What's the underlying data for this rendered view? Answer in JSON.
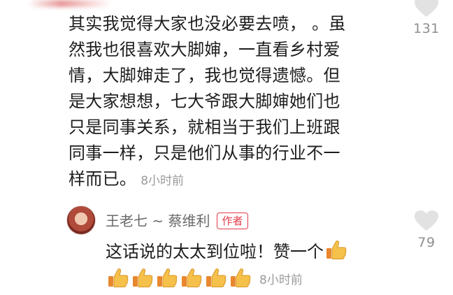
{
  "comment": {
    "lines": [
      "其实我觉得大家也没必要去喷，  。虽",
      "然我也很喜欢大脚婶，一直看乡村爱",
      "情，大脚婶走了，我也觉得遗憾。但",
      "是大家想想，七大爷跟大脚婶她们也",
      "只是同事关系，就相当于我们上班跟",
      "同事一样，只是他们从事的行业不一",
      "样而已。"
    ],
    "time": "8小时前",
    "likes": "131"
  },
  "reply": {
    "name": "王老七 ~ 蔡维利",
    "badge": "作者",
    "text": "这话说的太太到位啦！赞一个",
    "time": "8小时前",
    "likes": "79",
    "thumb_count": 6
  },
  "colors": {
    "badge": "#e33b4b",
    "secondary_text": "#9a9a9a",
    "thumb_fill": "#f5c14b",
    "thumb_cuff": "#e9872e"
  },
  "icons": [
    "heart-icon",
    "thumbs-up-emoji"
  ]
}
